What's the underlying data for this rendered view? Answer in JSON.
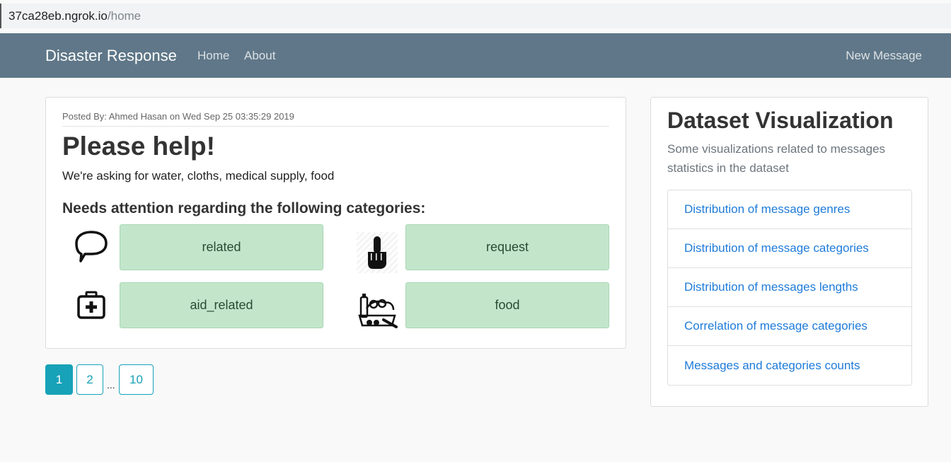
{
  "browser": {
    "host": "37ca28eb.ngrok.io",
    "path": "/home"
  },
  "navbar": {
    "brand": "Disaster Response",
    "links": [
      "Home",
      "About"
    ],
    "new_message": "New Message"
  },
  "message": {
    "posted_by": "Posted By: Ahmed Hasan  on Wed Sep 25 03:35:29 2019",
    "title": "Please help!",
    "body": "We're asking for water, cloths, medical supply, food",
    "categories_heading": "Needs attention regarding the following categories:",
    "categories": [
      {
        "label": "related",
        "icon": "speech-bubble-icon"
      },
      {
        "label": "request",
        "icon": "raised-finger-icon"
      },
      {
        "label": "aid_related",
        "icon": "first-aid-kit-icon"
      },
      {
        "label": "food",
        "icon": "groceries-icon"
      }
    ]
  },
  "pagination": {
    "pages": [
      "1",
      "2",
      "10"
    ],
    "current": "1",
    "ellipsis": "..."
  },
  "visualization": {
    "title": "Dataset Visualization",
    "description": "Some visualizations related to messages statistics in the dataset",
    "items": [
      "Distribution of message genres",
      "Distribution of message categories",
      "Distribution of messages lengths",
      "Correlation of message categories",
      "Messages and categories counts"
    ]
  },
  "colors": {
    "navbar": "#5f7788",
    "category_bg": "#c3e6cb",
    "pagination": "#17a2b8",
    "link": "#1e7bd9"
  }
}
